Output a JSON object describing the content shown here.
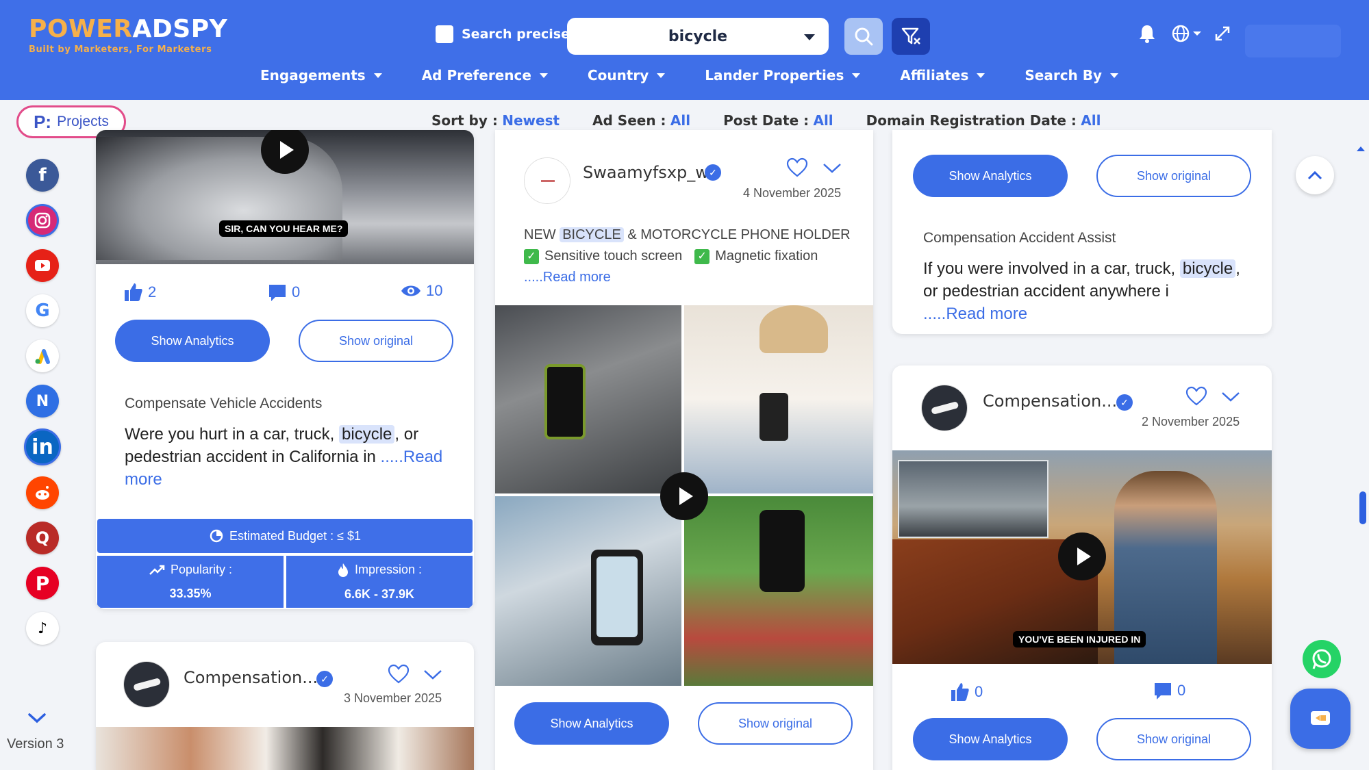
{
  "header": {
    "logo_main_1": "POWER",
    "logo_main_2": "ADSPY",
    "logo_tagline": "Built by Marketers, For Marketers",
    "search_precisely_label": "Search precisely",
    "search_value": "bicycle",
    "nav": [
      {
        "label": "Engagements"
      },
      {
        "label": "Ad Preference"
      },
      {
        "label": "Country"
      },
      {
        "label": "Lander Properties"
      },
      {
        "label": "Affiliates"
      },
      {
        "label": "Search By"
      }
    ]
  },
  "sortbar": {
    "projects_label": "Projects",
    "projects_badge": "P:",
    "sort_by_label": "Sort by :",
    "sort_by_value": "Newest",
    "ad_seen_label": "Ad Seen :",
    "ad_seen_value": "All",
    "post_date_label": "Post Date :",
    "post_date_value": "All",
    "domain_reg_label": "Domain Registration Date :",
    "domain_reg_value": "All"
  },
  "rail": {
    "version": "Version 3",
    "icons": [
      "facebook-icon",
      "instagram-icon",
      "youtube-icon",
      "google-icon",
      "google-ads-icon",
      "native-icon",
      "linkedin-icon",
      "reddit-icon",
      "quora-icon",
      "pinterest-icon",
      "tiktok-icon"
    ]
  },
  "card1": {
    "video_caption": "SIR, CAN YOU HEAR ME?",
    "likes": "2",
    "comments": "0",
    "views": "10",
    "show_analytics": "Show Analytics",
    "show_original": "Show original",
    "ad_title": "Compensate Vehicle Accidents",
    "body_pre": "Were you hurt in a car, truck, ",
    "body_hl": "bicycle",
    "body_post": ", or pedestrian accident in California in ",
    "read_more": ".....Read more",
    "budget_label": "Estimated Budget : ≤ $1",
    "popularity_label": "Popularity :",
    "popularity_value": "33.35%",
    "impression_label": "Impression :",
    "impression_value": "6.6K - 37.9K"
  },
  "card2": {
    "name": "Compensation...",
    "date": "3 November 2025"
  },
  "card3": {
    "name": "Swaamyfsxp_w",
    "date": "4 November 2025",
    "text_pre": "NEW ",
    "text_hl": "BICYCLE",
    "text_post": " & MOTORCYCLE PHONE HOLDER",
    "feature1": "Sensitive touch screen",
    "feature2": "Magnetic fixation",
    "read_more": ".....Read more",
    "show_analytics": "Show Analytics",
    "show_original": "Show original"
  },
  "card4": {
    "show_analytics": "Show Analytics",
    "show_original": "Show original",
    "ad_title": "Compensation Accident Assist",
    "body_pre": "If you were involved in a car, truck, ",
    "body_hl": "bicycle",
    "body_post": ", or pedestrian accident anywhere i",
    "read_more": ".....Read more"
  },
  "card5": {
    "name": "Compensation...",
    "date": "2 November 2025",
    "video_caption": "YOU'VE BEEN INJURED IN",
    "likes": "0",
    "comments": "0",
    "show_analytics": "Show Analytics",
    "show_original": "Show original"
  },
  "colors": {
    "brand_blue": "#3f6fe8",
    "logo_orange": "#f6b04a",
    "link_blue": "#3b6de6"
  }
}
